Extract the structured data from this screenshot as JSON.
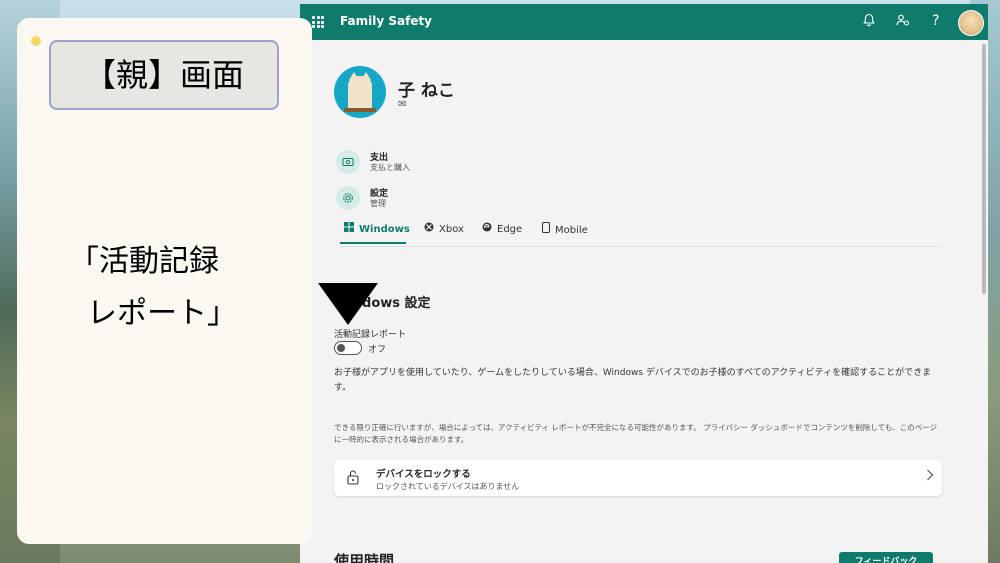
{
  "header": {
    "app_name": "Family Safety",
    "icons": [
      "bell-icon",
      "family-settings-icon",
      "help-icon",
      "user-avatar"
    ],
    "help_glyph": "?"
  },
  "profile": {
    "name": "子 ねこ",
    "mail_glyph": "✉"
  },
  "menu": [
    {
      "title": "支出",
      "subtitle": "支払と購入",
      "icon": "wallet-icon"
    },
    {
      "title": "設定",
      "subtitle": "管理",
      "icon": "gear-icon"
    }
  ],
  "tabs": [
    {
      "label": "Windows",
      "icon": "windows-icon",
      "active": true
    },
    {
      "label": "Xbox",
      "icon": "xbox-icon",
      "active": false
    },
    {
      "label": "Edge",
      "icon": "edge-icon",
      "active": false
    },
    {
      "label": "Mobile",
      "icon": "mobile-icon",
      "active": false
    }
  ],
  "windows_settings": {
    "title": "Windows 設定",
    "activity_report_label": "活動記録レポート",
    "toggle_state": "オフ",
    "description": "お子様がアプリを使用していたり、ゲームをしたりしている場合、Windows デバイスでのお子様のすべてのアクティビティを確認することができます。",
    "note": "できる限り正確に行いますが、場合によっては、アクティビティ レポートが不完全になる可能性があります。 プライバシー ダッシュボードでコンテンツを削除しても、このページに一時的に表示される場合があります。"
  },
  "lock_device": {
    "title": "デバイスをロックする",
    "subtitle": "ロックされているデバイスはありません"
  },
  "usage": {
    "title": "使用時間",
    "feedback_button": "フィードバック"
  },
  "annotation": {
    "label": "【親】画面",
    "line1": "「活動記録",
    "line2": "レポート」"
  },
  "colors": {
    "brand": "#0f7b6c",
    "label_border": "#9aa5d6"
  }
}
